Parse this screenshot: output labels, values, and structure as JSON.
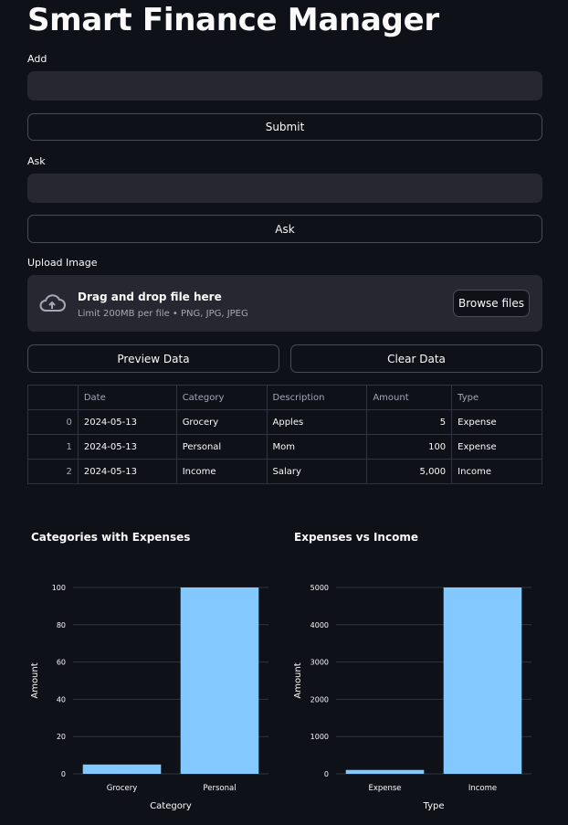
{
  "app": {
    "title": "Smart Finance Manager"
  },
  "add": {
    "label": "Add",
    "value": "",
    "submit_label": "Submit"
  },
  "ask": {
    "label": "Ask",
    "value": "",
    "button_label": "Ask"
  },
  "upload": {
    "label": "Upload Image",
    "drop_text": "Drag and drop file here",
    "limit_text": "Limit 200MB per file • PNG, JPG, JPEG",
    "browse_label": "Browse files"
  },
  "actions": {
    "preview_label": "Preview Data",
    "clear_label": "Clear Data"
  },
  "table": {
    "columns": [
      "",
      "Date",
      "Category",
      "Description",
      "Amount",
      "Type"
    ],
    "rows": [
      [
        "0",
        "2024-05-13",
        "Grocery",
        "Apples",
        "5",
        "Expense"
      ],
      [
        "1",
        "2024-05-13",
        "Personal",
        "Mom",
        "100",
        "Expense"
      ],
      [
        "2",
        "2024-05-13",
        "Income",
        "Salary",
        "5,000",
        "Income"
      ]
    ]
  },
  "colors": {
    "bar": "#83c9ff",
    "background": "#0e1117",
    "input": "#262730"
  },
  "chart_data": [
    {
      "type": "bar",
      "title": "Categories with Expenses",
      "categories": [
        "Grocery",
        "Personal"
      ],
      "values": [
        5,
        100
      ],
      "xlabel": "Category",
      "ylabel": "Amount",
      "ylim": [
        0,
        100
      ],
      "yticks": [
        0,
        20,
        40,
        60,
        80,
        100
      ],
      "grid": true
    },
    {
      "type": "bar",
      "title": "Expenses vs Income",
      "categories": [
        "Expense",
        "Income"
      ],
      "values": [
        105,
        5000
      ],
      "xlabel": "Type",
      "ylabel": "Amount",
      "ylim": [
        0,
        5000
      ],
      "yticks": [
        0,
        1000,
        2000,
        3000,
        4000,
        5000
      ],
      "grid": true
    }
  ]
}
